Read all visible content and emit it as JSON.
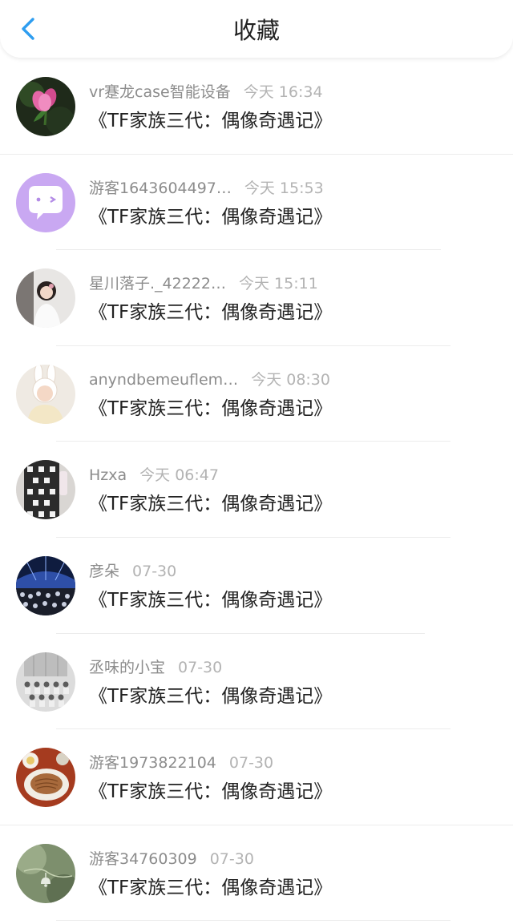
{
  "header": {
    "title": "收藏",
    "back_icon": "chevron-left-icon",
    "accent_color": "#2e9df0"
  },
  "items": [
    {
      "user": "vr蹇龙case智能设备",
      "time": "今天 16:34",
      "title": "《TF家族三代：偶像奇遇记》",
      "avatar": "pink-flower"
    },
    {
      "user": "游客1643604497…",
      "time": "今天 15:53",
      "title": "《TF家族三代：偶像奇遇记》",
      "avatar": "purple-chat-bubble"
    },
    {
      "user": "星川落子._42222…",
      "time": "今天 15:11",
      "title": "《TF家族三代：偶像奇遇记》",
      "avatar": "girl-photo"
    },
    {
      "user": "anyndbemeuflem…",
      "time": "今天 08:30",
      "title": "《TF家族三代：偶像奇遇记》",
      "avatar": "bunny-hat-photo"
    },
    {
      "user": "Hzxa",
      "time": "今天 06:47",
      "title": "《TF家族三代：偶像奇遇记》",
      "avatar": "plaid-outfit-photo"
    },
    {
      "user": "彦朵",
      "time": "07-30",
      "title": "《TF家族三代：偶像奇遇记》",
      "avatar": "concert-photo"
    },
    {
      "user": "丞味的小宝",
      "time": "07-30",
      "title": "《TF家族三代：偶像奇遇记》",
      "avatar": "group-photo"
    },
    {
      "user": "游客1973822104",
      "time": "07-30",
      "title": "《TF家族三代：偶像奇遇记》",
      "avatar": "food-photo"
    },
    {
      "user": "游客34760309",
      "time": "07-30",
      "title": "《TF家族三代：偶像奇遇记》",
      "avatar": "bell-plant-photo"
    }
  ]
}
